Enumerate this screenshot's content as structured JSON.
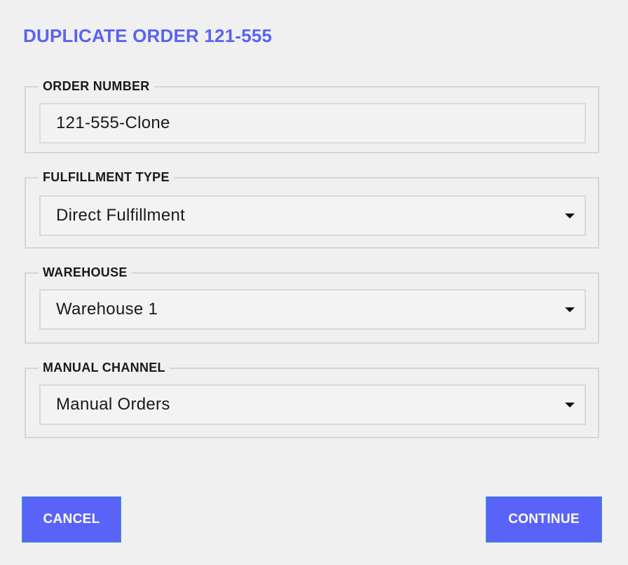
{
  "dialog": {
    "title": "DUPLICATE ORDER 121-555"
  },
  "fields": {
    "order_number": {
      "label": "ORDER NUMBER",
      "value": "121-555-Clone"
    },
    "fulfillment_type": {
      "label": "FULFILLMENT TYPE",
      "selected": "Direct Fulfillment"
    },
    "warehouse": {
      "label": "WAREHOUSE",
      "selected": "Warehouse 1"
    },
    "manual_channel": {
      "label": "MANUAL CHANNEL",
      "selected": "Manual Orders"
    }
  },
  "actions": {
    "cancel_label": "CANCEL",
    "continue_label": "CONTINUE"
  },
  "colors": {
    "accent": "#5a63f7",
    "title": "#5a63f0",
    "background": "#f0f0f0"
  },
  "icons": {
    "dropdown": "chevron-down-icon"
  }
}
